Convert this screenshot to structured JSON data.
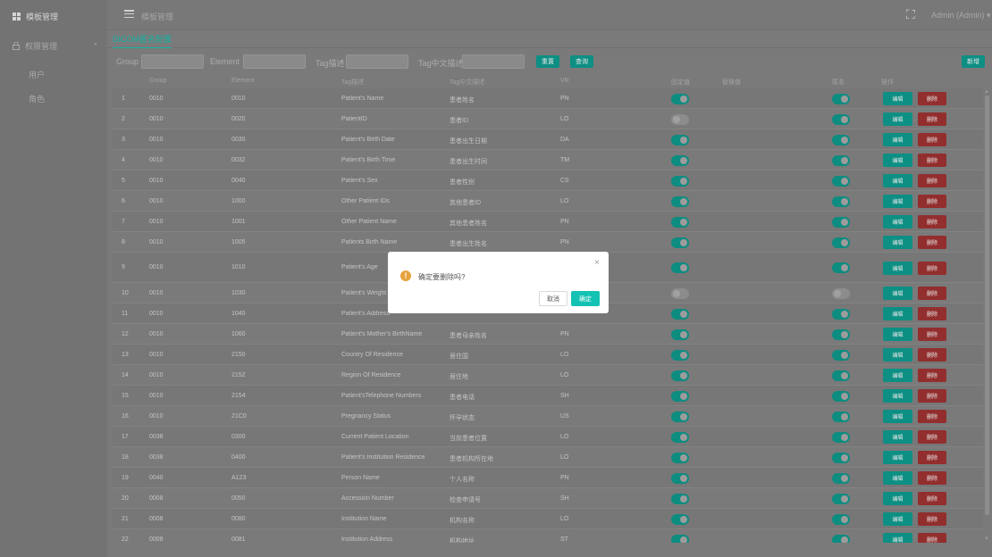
{
  "sidebar": {
    "brand_icon": "grid-icon",
    "brand": "模板管理",
    "items": [
      {
        "label": "权限管理",
        "icon": "lock-icon",
        "expanded": true
      },
      {
        "label": "用户"
      },
      {
        "label": "角色"
      }
    ]
  },
  "header": {
    "breadcrumb": "模板管理",
    "menu_icon": "menu-fold-icon",
    "fullscreen_icon": "fullscreen-icon",
    "user": "Admin (Admin) ▾"
  },
  "tabs": [
    {
      "label": "DICOM匿名配置",
      "active": true
    }
  ],
  "filter": {
    "group_label": "Group",
    "element_label": "Element",
    "tag_desc_label": "Tag描述",
    "tag_cn_label": "Tag中文描述",
    "group_value": "",
    "element_value": "",
    "tag_desc_value": "",
    "tag_cn_value": "",
    "reset_label": "重置",
    "search_label": "查询",
    "add_label": "新增"
  },
  "table": {
    "columns": [
      "Group",
      "Element",
      "Tag描述",
      "Tag中文描述",
      "VR",
      "固定值",
      "替换值",
      "匿名",
      "操作"
    ],
    "edit_label": "编辑",
    "delete_label": "删除",
    "rows": [
      {
        "no": "1",
        "group": "0010",
        "element": "0010",
        "tag": "Patient's Name",
        "cn": "患者姓名",
        "vr": "PN",
        "fixed": true,
        "anon": true
      },
      {
        "no": "2",
        "group": "0010",
        "element": "0020",
        "tag": "PatientID",
        "cn": "患者ID",
        "vr": "LO",
        "fixed": false,
        "anon": true
      },
      {
        "no": "3",
        "group": "0010",
        "element": "0030",
        "tag": "Patient's Birth Date",
        "cn": "患者出生日期",
        "vr": "DA",
        "fixed": true,
        "anon": true
      },
      {
        "no": "4",
        "group": "0010",
        "element": "0032",
        "tag": "Patient's Birth Time",
        "cn": "患者出生时间",
        "vr": "TM",
        "fixed": true,
        "anon": true
      },
      {
        "no": "5",
        "group": "0010",
        "element": "0040",
        "tag": "Patient's Sex",
        "cn": "患者性别",
        "vr": "CS",
        "fixed": true,
        "anon": true
      },
      {
        "no": "6",
        "group": "0010",
        "element": "1000",
        "tag": "Other Patient IDs",
        "cn": "其他患者ID",
        "vr": "LO",
        "fixed": true,
        "anon": true
      },
      {
        "no": "7",
        "group": "0010",
        "element": "1001",
        "tag": "Other Patient Name",
        "cn": "其他患者姓名",
        "vr": "PN",
        "fixed": true,
        "anon": true
      },
      {
        "no": "8",
        "group": "0010",
        "element": "1005",
        "tag": "Patients Birth Name",
        "cn": "患者出生姓名",
        "vr": "PN",
        "fixed": true,
        "anon": true
      },
      {
        "no": "9",
        "group": "0010",
        "element": "1010",
        "tag": "Patient's Age",
        "cn": "",
        "vr": "",
        "fixed": true,
        "anon": true
      },
      {
        "no": "10",
        "group": "0010",
        "element": "1030",
        "tag": "Patient's Weight",
        "cn": "",
        "vr": "",
        "fixed": false,
        "anon": false
      },
      {
        "no": "11",
        "group": "0010",
        "element": "1040",
        "tag": "Patient's Address",
        "cn": "",
        "vr": "",
        "fixed": true,
        "anon": true
      },
      {
        "no": "12",
        "group": "0010",
        "element": "1060",
        "tag": "Patient's Mother's BirthName",
        "cn": "患者母亲姓名",
        "vr": "PN",
        "fixed": true,
        "anon": true
      },
      {
        "no": "13",
        "group": "0010",
        "element": "2150",
        "tag": "Country Of Residence",
        "cn": "居住国",
        "vr": "LO",
        "fixed": true,
        "anon": true
      },
      {
        "no": "14",
        "group": "0010",
        "element": "2152",
        "tag": "Region Of Residence",
        "cn": "居住地",
        "vr": "LO",
        "fixed": true,
        "anon": true
      },
      {
        "no": "15",
        "group": "0010",
        "element": "2154",
        "tag": "Patient'sTelephone Numbers",
        "cn": "患者电话",
        "vr": "SH",
        "fixed": true,
        "anon": true
      },
      {
        "no": "16",
        "group": "0010",
        "element": "21C0",
        "tag": "Pregnancy Status",
        "cn": "怀孕状态",
        "vr": "US",
        "fixed": true,
        "anon": true
      },
      {
        "no": "17",
        "group": "0038",
        "element": "0300",
        "tag": "Current Patient Location",
        "cn": "当前患者位置",
        "vr": "LO",
        "fixed": true,
        "anon": true
      },
      {
        "no": "18",
        "group": "0038",
        "element": "0400",
        "tag": "Patient's Institution Residence",
        "cn": "患者机构所在地",
        "vr": "LO",
        "fixed": true,
        "anon": true
      },
      {
        "no": "19",
        "group": "0040",
        "element": "A123",
        "tag": "Person Name",
        "cn": "个人名称",
        "vr": "PN",
        "fixed": true,
        "anon": true
      },
      {
        "no": "20",
        "group": "0008",
        "element": "0050",
        "tag": "Accession Number",
        "cn": "检查申请号",
        "vr": "SH",
        "fixed": true,
        "anon": true
      },
      {
        "no": "21",
        "group": "0008",
        "element": "0080",
        "tag": "Institution Name",
        "cn": "机构名称",
        "vr": "LO",
        "fixed": true,
        "anon": true
      },
      {
        "no": "22",
        "group": "0008",
        "element": "0081",
        "tag": "Institution Address",
        "cn": "机构地址",
        "vr": "ST",
        "fixed": true,
        "anon": true
      }
    ]
  },
  "dialog": {
    "message": "确定要删除吗?",
    "cancel_label": "取消",
    "confirm_label": "确定",
    "close_glyph": "×",
    "icon": "warning-icon",
    "icon_glyph": "!"
  },
  "colors": {
    "accent": "#13c2b3",
    "danger": "#d9534f",
    "warning": "#e6a23c",
    "overlay_tint": "#808080"
  }
}
